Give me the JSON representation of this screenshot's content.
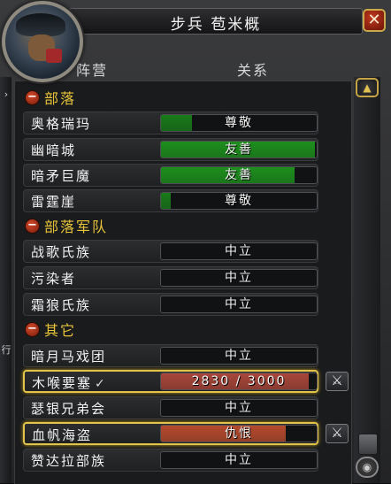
{
  "window": {
    "title": "步兵 苞米概",
    "close_label": "✕"
  },
  "columns": {
    "faction": "阵营",
    "relation": "关系"
  },
  "side_tab": {
    "arrow": "›",
    "text": "行"
  },
  "headers": [
    {
      "label": "部落",
      "toggle": "−"
    },
    {
      "label": "部落军队",
      "toggle": "−"
    },
    {
      "label": "其它",
      "toggle": "−"
    }
  ],
  "rows": [
    {
      "name": "奥格瑞玛",
      "standing": "尊敬",
      "fill": 0.2,
      "color": "#1a7a1a"
    },
    {
      "name": "幽暗城",
      "standing": "友善",
      "fill": 0.99,
      "color": "#1d8f1d"
    },
    {
      "name": "暗矛巨魔",
      "standing": "友善",
      "fill": 0.86,
      "color": "#1d8f1d"
    },
    {
      "name": "雷霆崖",
      "standing": "尊敬",
      "fill": 0.06,
      "color": "#1a7a1a"
    },
    {
      "name": "战歌氏族",
      "standing": "中立",
      "fill": 0.0,
      "color": "#1d8f1d"
    },
    {
      "name": "污染者",
      "standing": "中立",
      "fill": 0.0,
      "color": "#1d8f1d"
    },
    {
      "name": "霜狼氏族",
      "standing": "中立",
      "fill": 0.0,
      "color": "#1d8f1d"
    },
    {
      "name": "暗月马戏团",
      "standing": "中立",
      "fill": 0.0,
      "color": "#1d8f1d"
    },
    {
      "name": "木喉要塞",
      "standing": "2830 / 3000",
      "fill": 0.95,
      "color": "#a8463a",
      "checked": true,
      "highlighted": true
    },
    {
      "name": "瑟银兄弟会",
      "standing": "中立",
      "fill": 0.0,
      "color": "#1d8f1d"
    },
    {
      "name": "血帆海盗",
      "standing": "仇恨",
      "fill": 0.8,
      "color": "#b54a2e",
      "highlighted": true
    },
    {
      "name": "赞达拉部族",
      "standing": "中立",
      "fill": 0.0,
      "color": "#1d8f1d"
    }
  ],
  "check_mark": "✓",
  "war_toggle_icon": "⚔",
  "scroll": {
    "up": "▲",
    "down": "◉"
  }
}
